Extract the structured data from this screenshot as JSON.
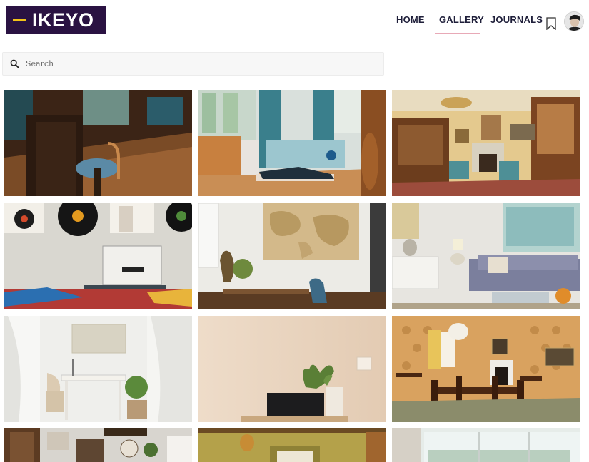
{
  "brand": {
    "name": "IKEYO",
    "accent": "#f2c318",
    "background": "#2a1242"
  },
  "nav": {
    "items": [
      {
        "label": "HOME"
      },
      {
        "label": "GALLERY",
        "active": true
      },
      {
        "label": "JOURNALS"
      }
    ],
    "bookmark_icon": "bookmark-icon",
    "avatar_icon": "user-avatar"
  },
  "search": {
    "placeholder": "Search",
    "value": "",
    "icon": "search-icon"
  },
  "gallery": {
    "tiles": [
      {
        "name": "vintage-room-wood-floor"
      },
      {
        "name": "living-room-woman-lying"
      },
      {
        "name": "classic-yellow-lounge"
      },
      {
        "name": "record-player-vinyl-wall"
      },
      {
        "name": "world-map-desk-room"
      },
      {
        "name": "grey-sofa-living-room"
      },
      {
        "name": "white-desk-chair-room"
      },
      {
        "name": "plant-laptop-beige-wall"
      },
      {
        "name": "patterned-dining-room"
      },
      {
        "name": "shelf-clock-room"
      },
      {
        "name": "yellow-wall-kitchen"
      },
      {
        "name": "bright-window-room"
      }
    ]
  }
}
